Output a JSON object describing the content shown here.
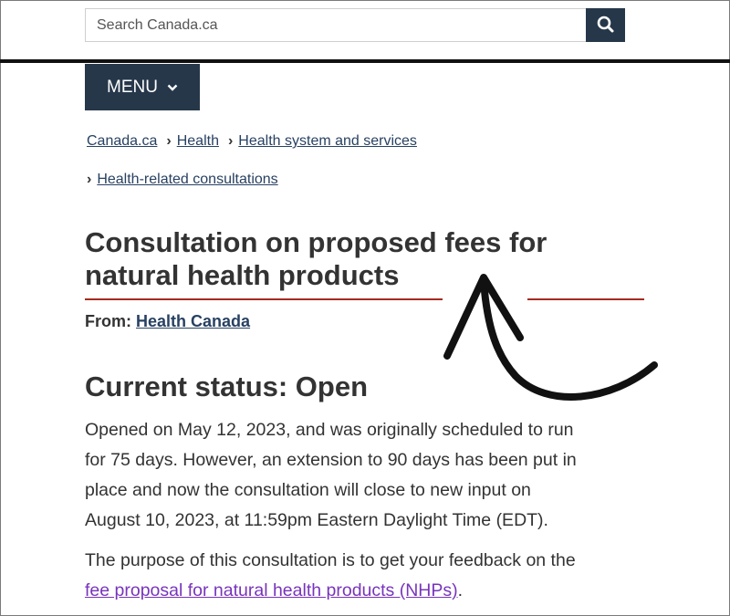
{
  "search": {
    "placeholder": "Search Canada.ca"
  },
  "icons": {
    "search": "search-icon",
    "menu_chevron": "chevron-down-icon",
    "breadcrumb_separator": "chevron-right-icon",
    "annotation": "hand-drawn-arrow"
  },
  "menu": {
    "label": "MENU"
  },
  "breadcrumb": {
    "items": [
      "Canada.ca",
      "Health",
      "Health system and services",
      "Health-related consultations"
    ]
  },
  "page": {
    "title_line1": "Consultation on proposed fees for",
    "title_line2": "natural health products",
    "from_label": "From:",
    "from_value": "Health Canada",
    "status_heading": "Current status: Open",
    "status_paragraph": [
      "Opened on May 12, 2023, and was originally scheduled to run",
      "for 75 days. However, an extension to 90 days has been put in",
      "place and now the consultation will close to new input on",
      "August 10, 2023, at 11:59pm Eastern Daylight Time (EDT)."
    ],
    "purpose_text": "The purpose of this consultation is to get your feedback on the",
    "purpose_link": "fee proposal for natural health products (NHPs)",
    "purpose_end": "."
  },
  "colors": {
    "gc_navy": "#26374a",
    "link": "#284162",
    "visited_link": "#7834bc",
    "title_rule": "#a62a1e"
  }
}
